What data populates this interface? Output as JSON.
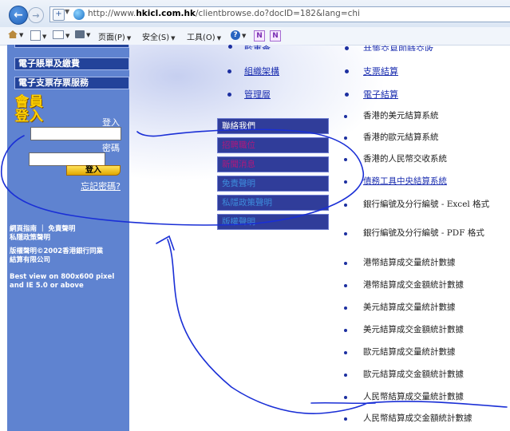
{
  "browser": {
    "url_prefix": "http://www.",
    "url_domain": "hkicl.com.hk",
    "url_path": "/clientbrowse.do?docID=182&lang=chi",
    "commands": {
      "page": "页面(P)",
      "safety": "安全(S)",
      "tools": "工具(O)"
    }
  },
  "sidebar": {
    "buttons": [
      "電子賬單及繳費",
      "電子支票存票服務"
    ],
    "login_title": "會員登入",
    "login_label": "登入",
    "password_label": "密碼",
    "login_button": "登入",
    "forgot_password": "忘記密碼?",
    "footer": {
      "line1": "網頁指南 ｜ 免責聲明",
      "line2": "私隱政策聲明",
      "line3": "版權聲明©2002香港銀行同業",
      "line4": "結算有限公司",
      "line5": "Best view on 800x600 pixel",
      "line6": "and IE 5.0 or above"
    }
  },
  "top_links": {
    "top_left_cut": "監事會",
    "top_right_cut": "共籌交易即時交收",
    "org": "組織架構",
    "mgmt": "管理層",
    "cheque": "支票結算",
    "eclear": "電子結算"
  },
  "menu": [
    {
      "label": "聯絡我們",
      "color": "#ffffff"
    },
    {
      "label": "招聘職位",
      "color": "#b0187c"
    },
    {
      "label": "新聞消息",
      "color": "#b0187c"
    },
    {
      "label": "免責聲明",
      "color": "#3d8bdb"
    },
    {
      "label": "私隱政策聲明",
      "color": "#3d8bdb"
    },
    {
      "label": "版權聲明",
      "color": "#3d8bdb"
    }
  ],
  "list": [
    "香港的美元結算系統",
    "香港的歐元結算系統",
    "香港的人民幣交收系統",
    "債務工具中央結算系統",
    "銀行編號及分行編號 - Excel 格式",
    "銀行編號及分行編號 - PDF 格式",
    "港幣結算成交量統計數據",
    "港幣結算成交金額統計數據",
    "美元結算成交量統計數據",
    "美元結算成交金額統計數據",
    "歐元結算成交量統計數據",
    "歐元結算成交金額統計數據",
    "人民幣結算成交量統計數據",
    "人民幣結算成交金額統計數據"
  ],
  "annotation_color": "#1a2fd6"
}
